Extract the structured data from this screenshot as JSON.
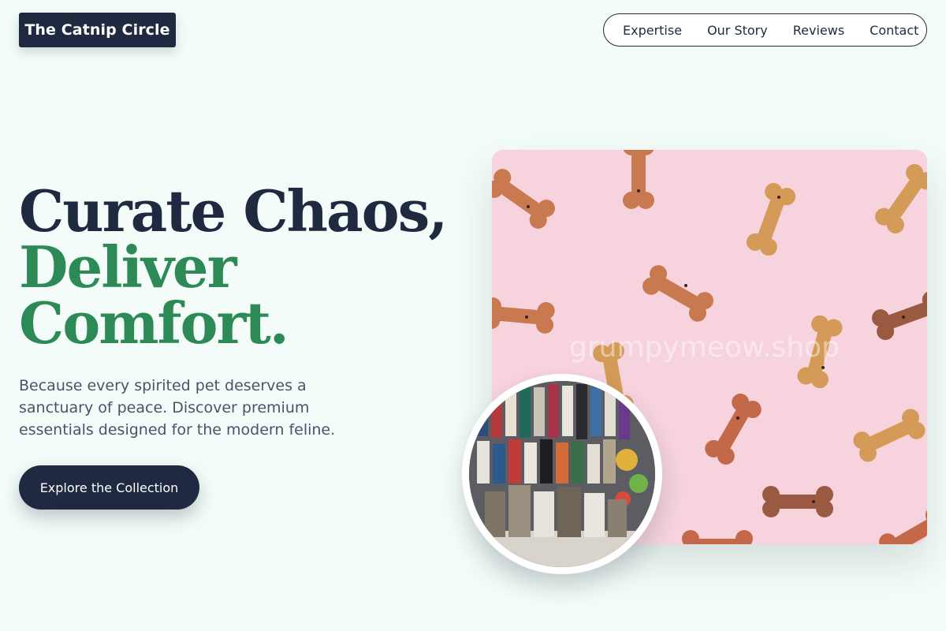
{
  "brand": {
    "name": "The Catnip Circle"
  },
  "nav": {
    "items": [
      "Expertise",
      "Our Story",
      "Reviews",
      "Contact"
    ]
  },
  "hero": {
    "headline_line1": "Curate Chaos,",
    "headline_line2": "Deliver",
    "headline_line3": "Comfort.",
    "subtext": "Because every spirited pet deserves a sanctuary of peace. Discover premium essentials designed for the modern feline.",
    "cta_label": "Explore the Collection"
  },
  "images": {
    "main_watermark": "grumpymeow.shop",
    "main_subject": "dog biscuit bones on pink background",
    "circle_subject": "pet store shelves with clothing and food bags"
  },
  "colors": {
    "background": "#f3fcf8",
    "navy": "#1f2a40",
    "green_accent": "#2d8a57",
    "body_text": "#475569",
    "pink_bg": "#f6d3dd"
  }
}
